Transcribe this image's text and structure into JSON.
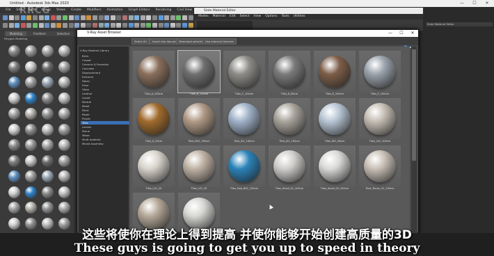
{
  "app": {
    "title": "Untitled - Autodesk 3ds Max 2020",
    "window_controls": [
      "—",
      "☐",
      "✕"
    ],
    "menu": [
      "File",
      "Edit",
      "Tools",
      "Group",
      "Views",
      "Create",
      "Modifiers",
      "Animation",
      "Graph Editors",
      "Rendering",
      "Civil View"
    ]
  },
  "slate": {
    "title": "Slate Material Editor",
    "menu": [
      "Modes",
      "Material",
      "Edit",
      "Select",
      "View",
      "Options",
      "Tools",
      "Utilities"
    ],
    "right_panel_title": "Slate Material Editor"
  },
  "left_panel": {
    "tabs": [
      "Modeling",
      "Freeform",
      "Selection"
    ],
    "label": "Polygon Modeling"
  },
  "browser": {
    "title": "V-Ray Asset Browser",
    "window_controls": [
      "—",
      "☐",
      "✕"
    ],
    "toolbar": [
      "Select All",
      "Insert into document",
      "Download selected",
      "Use external textures"
    ],
    "tree_root": "V-Ray Material Library",
    "tree_items": [
      "Brick",
      "Carpet",
      "Ceramic & Porcelain",
      "Concrete",
      "Displacement",
      "Extreme",
      "Fabric",
      "Floor",
      "Glass",
      "Leather",
      "Liquid",
      "Marble",
      "Metal",
      "Paint",
      "Paper",
      "Plastic",
      "Tiles",
      "Leaves",
      "Stone",
      "Wood",
      "Multi-material",
      "Mixed Assembly"
    ],
    "selected_tree_item": "Tiles",
    "materials": [
      {
        "name": "Tiles_A_100cm",
        "ball": "#8a6f5c"
      },
      {
        "name": "Tiles_B_120cm",
        "ball": "#6f6f6f"
      },
      {
        "name": "Tiles_C_100cm",
        "ball": "#8e8c88"
      },
      {
        "name": "Tiles_D_80cm",
        "ball": "#7a7a7a"
      },
      {
        "name": "Tiles_E_100cm",
        "ball": "#7d5e48"
      },
      {
        "name": "Tiles_F_100cm",
        "ball": "#9aa2ac"
      },
      {
        "name": "Tiles_G_20cm",
        "ball": "#a06a2c"
      },
      {
        "name": "Tiles_H01_100cm",
        "ball": "#b09a86"
      },
      {
        "name": "Tiles_I01_100cm",
        "ball": "#9fb1c8"
      },
      {
        "name": "Tiles_J01_100cm",
        "ball": "#a8a39b"
      },
      {
        "name": "Tiles_K01_60cm",
        "ball": "#b6c4d3"
      },
      {
        "name": "Tiles_L01_100cm",
        "ball": "#c4bdb3"
      },
      {
        "name": "Tiles_L01_20",
        "ball": "#d8d4cc"
      },
      {
        "name": "Tiles_L01_20",
        "ball": "#bfb2a4"
      },
      {
        "name": "Tiles_Pool_B01_100cm",
        "ball": "#2b82b8"
      },
      {
        "name": "Tiles_Small_01_100cm",
        "ball": "#cfcdca"
      },
      {
        "name": "Tiles_Small_02_100cm",
        "ball": "#d9d9d7"
      },
      {
        "name": "Tiles_Terrac_01_100cm",
        "ball": "#c8bfb6"
      },
      {
        "name": "",
        "ball": "#b4a898"
      },
      {
        "name": "",
        "ball": "#d6d6d3"
      }
    ],
    "selected_index": 1
  },
  "subtitles": {
    "cn": "这些将使你在理论上得到提高 并使你能够开始创建高质量的3D",
    "en": "These guys is going to get you up to speed in theory"
  },
  "watermark": "RRCG"
}
